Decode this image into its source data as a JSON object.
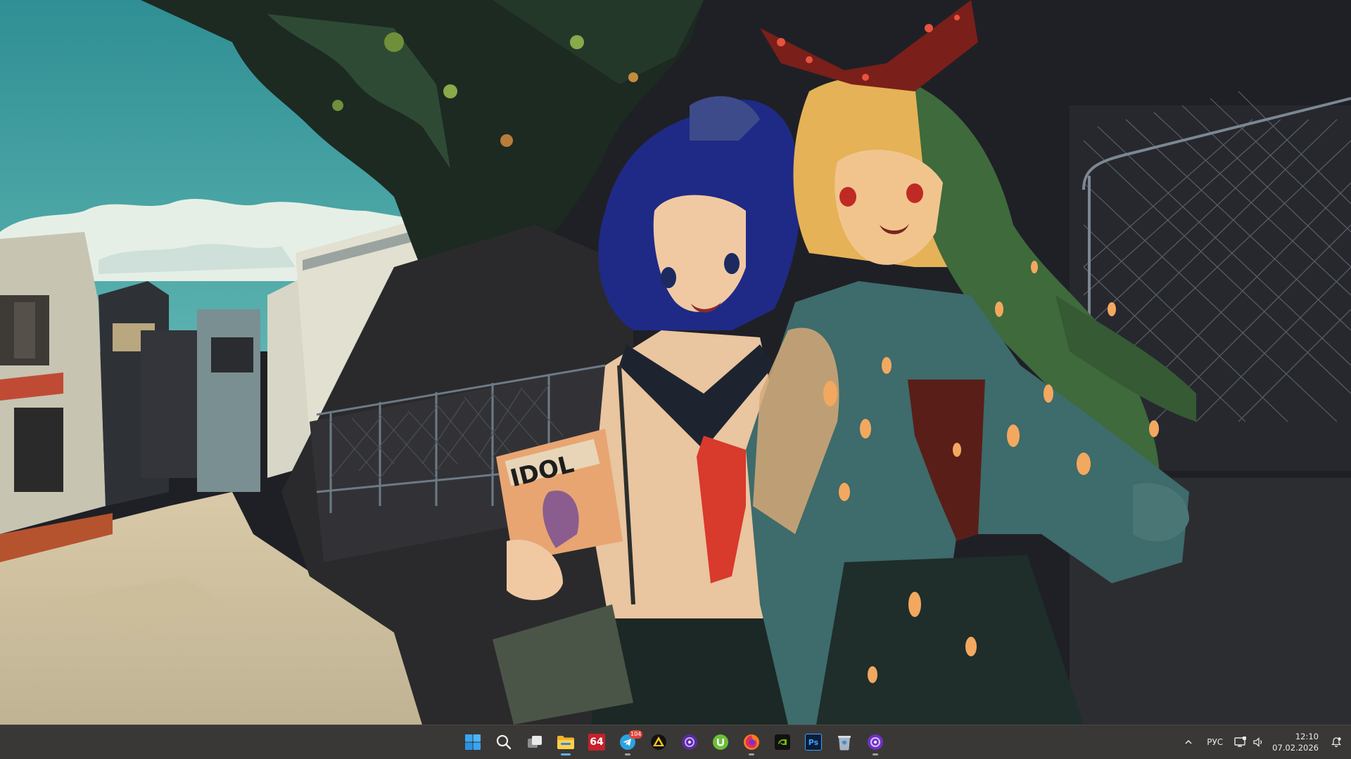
{
  "wallpaper": {
    "magazine_title": "IDOL"
  },
  "taskbar": {
    "apps": [
      {
        "name": "start-button",
        "icon": "windows-logo-icon",
        "running": false
      },
      {
        "name": "search-button",
        "icon": "search-icon",
        "running": false
      },
      {
        "name": "task-view-button",
        "icon": "task-view-icon",
        "running": false
      },
      {
        "name": "file-explorer-button",
        "icon": "folder-icon",
        "running": true
      },
      {
        "name": "aida64-button",
        "icon": "aida64-icon",
        "label": "64",
        "running": false
      },
      {
        "name": "telegram-button",
        "icon": "telegram-icon",
        "badge": "104",
        "running": true
      },
      {
        "name": "launcher-a-button",
        "icon": "triangle-logo-icon",
        "running": false
      },
      {
        "name": "purple-app-button",
        "icon": "purple-circle-icon",
        "running": false
      },
      {
        "name": "utorrent-button",
        "icon": "utorrent-icon",
        "running": false
      },
      {
        "name": "firefox-button",
        "icon": "firefox-icon",
        "running": true
      },
      {
        "name": "nvidia-button",
        "icon": "nvidia-icon",
        "running": false
      },
      {
        "name": "photoshop-button",
        "icon": "photoshop-icon",
        "label": "Ps",
        "running": false
      },
      {
        "name": "recycle-bin-button",
        "icon": "recycle-bin-icon",
        "running": false
      },
      {
        "name": "purple-app-2-button",
        "icon": "purple-circle-icon",
        "running": true
      }
    ],
    "tray": {
      "overflow_icon": "chevron-up-icon",
      "language": "РУС",
      "network_icon": "network-icon",
      "volume_icon": "speaker-icon",
      "time": "12:10",
      "date": "07.02.2026",
      "notification_icon": "notification-bell-icon"
    }
  }
}
